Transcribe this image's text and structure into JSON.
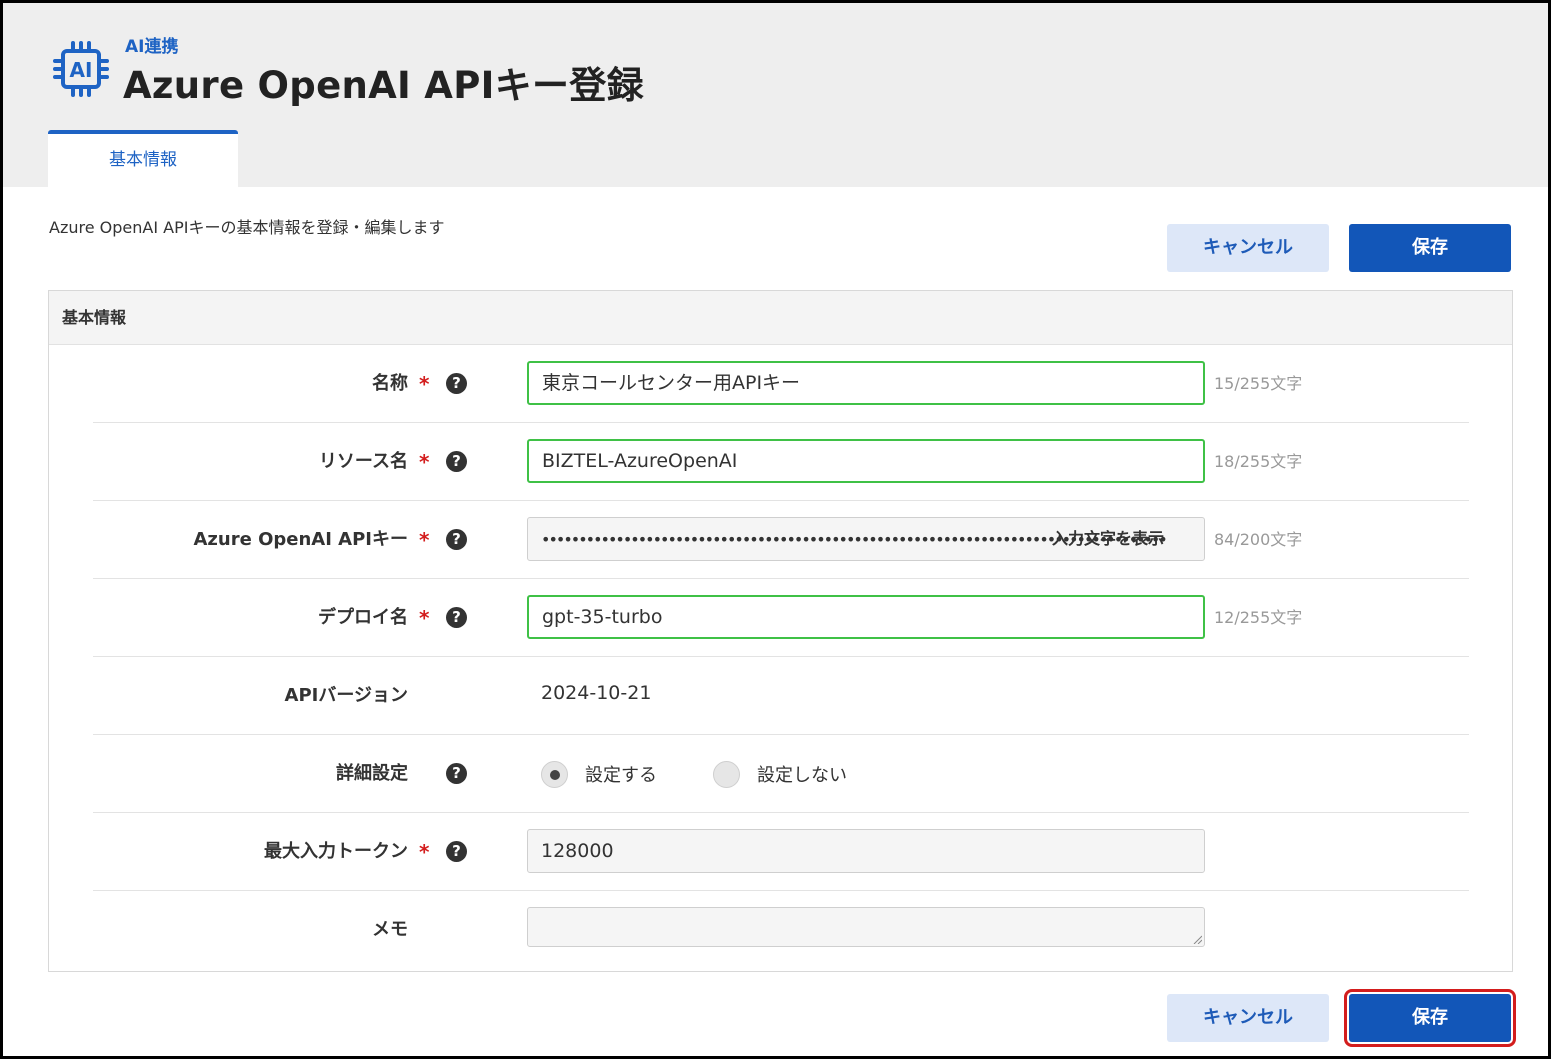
{
  "header": {
    "breadcrumb": "AI連携",
    "title": "Azure OpenAI APIキー登録"
  },
  "tabs": [
    {
      "label": "基本情報"
    }
  ],
  "description": "Azure OpenAI APIキーの基本情報を登録・編集します",
  "buttons": {
    "cancel": "キャンセル",
    "save": "保存"
  },
  "panel": {
    "title": "基本情報",
    "required_mark": "*",
    "help_mark": "?",
    "fields": {
      "name": {
        "label": "名称",
        "value": "東京コールセンター用APIキー",
        "counter": "15/255文字"
      },
      "resource": {
        "label": "リソース名",
        "value": "BIZTEL-AzureOpenAI",
        "counter": "18/255文字"
      },
      "apikey": {
        "label": "Azure OpenAI APIキー",
        "value": "••••••••••••••••••••••••••••••••••••••••••••••••••••••••••••••••••••••••••••••••••••",
        "reveal": "入力文字を表示",
        "counter": "84/200文字"
      },
      "deploy": {
        "label": "デプロイ名",
        "value": "gpt-35-turbo",
        "counter": "12/255文字"
      },
      "apiversion": {
        "label": "APIバージョン",
        "value": "2024-10-21"
      },
      "advanced": {
        "label": "詳細設定",
        "options": [
          "設定する",
          "設定しない"
        ],
        "selected": "設定する"
      },
      "maxtokens": {
        "label": "最大入力トークン",
        "value": "128000"
      },
      "memo": {
        "label": "メモ",
        "value": ""
      }
    }
  },
  "colors": {
    "accent": "#1256b8",
    "valid_border": "#3fc146",
    "required": "#d31d1d",
    "highlight": "#d31d1d"
  }
}
